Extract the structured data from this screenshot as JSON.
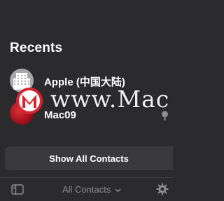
{
  "recents": {
    "title": "Recents",
    "contacts": [
      {
        "name": "Apple (中国大陆)",
        "avatar": "building-icon"
      },
      {
        "name": "Mac09",
        "avatar": "red-sphere-avatar"
      }
    ]
  },
  "watermark": {
    "text": "www.Mac"
  },
  "show_all_label": "Show All Contacts",
  "toolbar": {
    "filter_label": "All Contacts",
    "sidebar_icon": "sidebar-icon",
    "filter_icon": "chevron-down-icon",
    "gear_icon": "gear-icon"
  },
  "colors": {
    "background": "#2b2b2e",
    "button_bg": "#3a3a3d",
    "muted_text": "#8e8e93",
    "watermark_red": "#d6252e"
  }
}
